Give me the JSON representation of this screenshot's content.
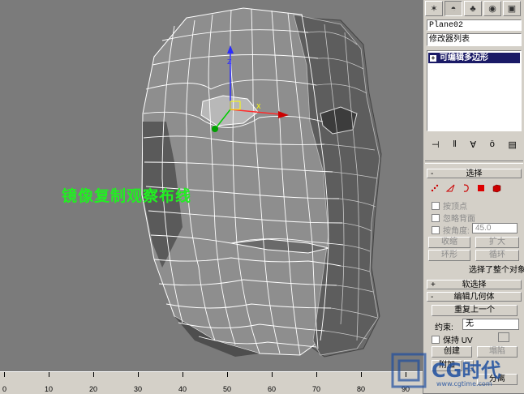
{
  "viewport": {
    "overlay_text": "镜像复制观察布线",
    "colors": {
      "wire": "#ffffff",
      "face_light": "#9a9a9a",
      "face_dark": "#4a4a4a",
      "background": "#7b7b7b",
      "text": "#22ee22"
    }
  },
  "timeline": {
    "labels": [
      "0",
      "10",
      "20",
      "30",
      "40",
      "50",
      "60",
      "70",
      "80",
      "90"
    ]
  },
  "command_panel": {
    "tabs": [
      {
        "icon": "create-icon",
        "glyph": "✶"
      },
      {
        "icon": "modify-icon",
        "glyph": "◓"
      },
      {
        "icon": "hierarchy-icon",
        "glyph": "♣"
      },
      {
        "icon": "motion-icon",
        "glyph": "◉"
      },
      {
        "icon": "display-icon",
        "glyph": "▣"
      }
    ],
    "object_name": "Plane02",
    "modifier_list": "修改器列表",
    "stack_item": "可编辑多边形",
    "stack_item_toggle": "+",
    "selection": {
      "title": "选择",
      "sign": "-",
      "by_vertex": "按顶点",
      "ignore_backfacing": "忽略背面",
      "by_angle": "按角度:",
      "angle_value": "45.0",
      "shrink": "收缩",
      "grow": "扩大",
      "ring": "环形",
      "loop": "循环",
      "status": "选择了整个对象"
    },
    "soft_selection": {
      "title": "软选择",
      "sign": "+"
    },
    "edit_geometry": {
      "title": "编辑几何体",
      "sign": "-",
      "repeat_last": "重复上一个",
      "constraints_label": "约束:",
      "constraints_value": "无",
      "preserve_uv": "保持 UV",
      "create": "创建",
      "collapse": "塌陷",
      "attach": "附加",
      "detach": "分离"
    }
  },
  "watermark": {
    "text": "CG时代",
    "subtext": "www.cgtime.com"
  }
}
